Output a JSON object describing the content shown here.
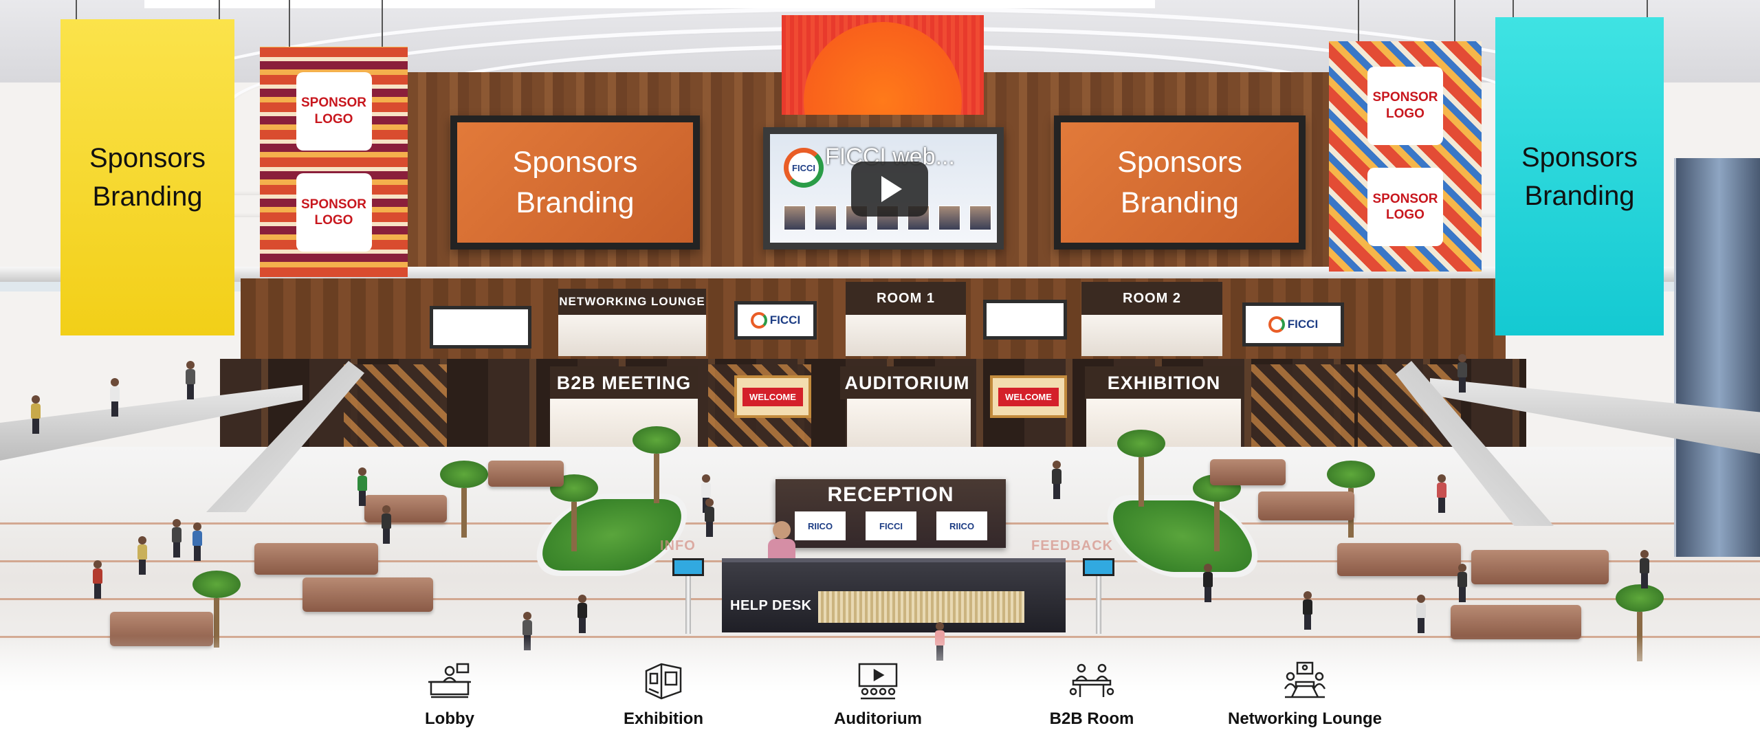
{
  "banners": {
    "left_text": "Sponsors Branding",
    "right_text": "Sponsors Branding"
  },
  "patterned_banners": {
    "left_logos": [
      "SPONSOR LOGO",
      "SPONSOR LOGO"
    ],
    "right_logos": [
      "SPONSOR LOGO",
      "SPONSOR LOGO"
    ]
  },
  "screens": {
    "left": "Sponsors Branding",
    "right": "Sponsors Branding",
    "video_title": "FICCI web...",
    "video_brand": "FICCI"
  },
  "mezzanine": {
    "networking": "NETWORKING LOUNGE",
    "room1": "ROOM 1",
    "room2": "ROOM 2",
    "screen_logo": "FICCI"
  },
  "halls": {
    "b2b": "B2B MEETING",
    "auditorium": "AUDITORIUM",
    "exhibition": "EXHIBITION",
    "welcome": "WELCOME"
  },
  "reception": {
    "title": "RECEPTION",
    "logos": [
      "RIICO",
      "FICCI",
      "RIICO"
    ],
    "desk_label": "HELP DESK",
    "info": "INFO",
    "feedback": "FEEDBACK"
  },
  "nav": {
    "items": [
      {
        "label": "Lobby",
        "icon": "reception-desk-icon"
      },
      {
        "label": "Exhibition",
        "icon": "exhibition-booth-icon"
      },
      {
        "label": "Auditorium",
        "icon": "presentation-screen-icon"
      },
      {
        "label": "B2B Room",
        "icon": "meeting-table-icon"
      },
      {
        "label": "Networking Lounge",
        "icon": "networking-group-icon"
      }
    ]
  },
  "colors": {
    "banner_yellow": "#f2cf18",
    "banner_cyan": "#14c9d2",
    "screen_orange": "#d96a30",
    "sign_brown": "#3a2a21"
  }
}
